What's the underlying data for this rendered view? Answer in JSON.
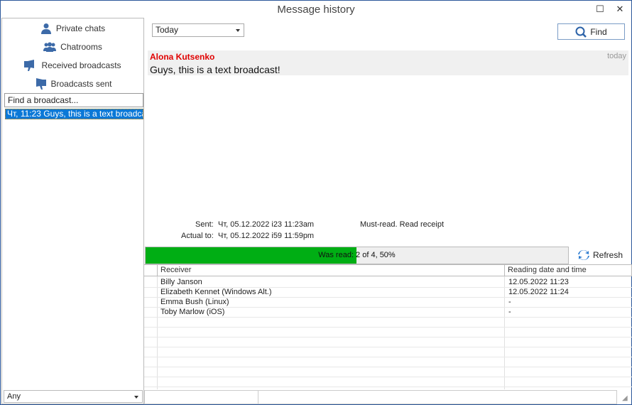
{
  "window": {
    "title": "Message history",
    "maximize_icon": "maximize-icon",
    "close_icon": "close-icon"
  },
  "sidebar": {
    "items": [
      {
        "label": "Private chats",
        "icon": "user-icon"
      },
      {
        "label": "Chatrooms",
        "icon": "users-icon"
      },
      {
        "label": "Received broadcasts",
        "icon": "megaphone-in-icon"
      },
      {
        "label": "Broadcasts sent",
        "icon": "megaphone-out-icon"
      }
    ],
    "search_placeholder": "Find a broadcast...",
    "list": [
      {
        "label": "Чт, 11:23 Guys, this is a text broadca..."
      }
    ],
    "filter": "Any"
  },
  "toolbar": {
    "period": "Today",
    "find_label": "Find"
  },
  "message": {
    "author": "Alona Kutsenko",
    "when": "today",
    "text": "Guys, this is a text broadcast!",
    "author_color": "#e00000"
  },
  "details": {
    "sent_label": "Sent:",
    "sent_value": "Чт, 05.12.2022 i23 11:23am",
    "actual_label": "Actual to:",
    "actual_value": "Чт, 05.12.2022 i59 11:59pm",
    "flags": "Must-read. Read receipt"
  },
  "progress": {
    "label": "Was read: 2 of 4, 50%",
    "percent": 50,
    "color": "#00ae14"
  },
  "refresh_label": "Refresh",
  "table": {
    "columns": [
      "Receiver",
      "Reading date and time"
    ],
    "rows": [
      {
        "receiver": "Billy Janson",
        "time": "12.05.2022 11:23"
      },
      {
        "receiver": "Elizabeth Kennet (Windows Alt.)",
        "time": "12.05.2022 11:24"
      },
      {
        "receiver": "Emma Bush (Linux)",
        "time": "-"
      },
      {
        "receiver": "Toby Marlow (iOS)",
        "time": "-"
      }
    ]
  }
}
